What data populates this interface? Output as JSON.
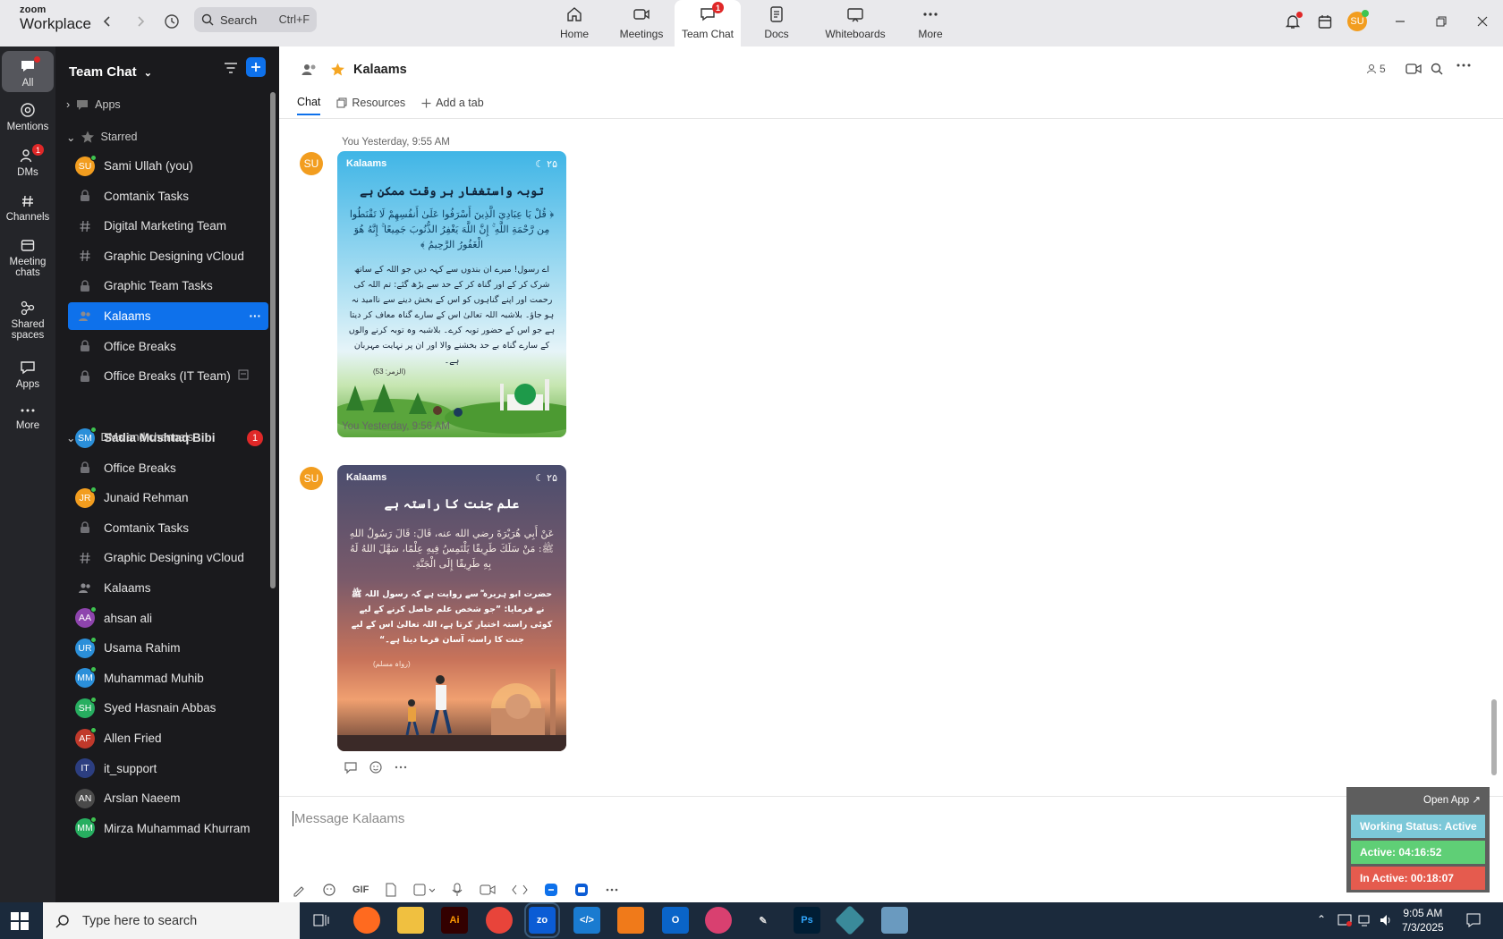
{
  "app": {
    "logo_top": "zoom",
    "logo_bottom": "Workplace"
  },
  "search": {
    "label": "Search",
    "shortcut": "Ctrl+F"
  },
  "nav_tabs": [
    {
      "label": "Home",
      "icon": "home-icon"
    },
    {
      "label": "Meetings",
      "icon": "video-icon"
    },
    {
      "label": "Team Chat",
      "icon": "chat-icon",
      "badge": "1",
      "active": true
    },
    {
      "label": "Docs",
      "icon": "doc-icon"
    },
    {
      "label": "Whiteboards",
      "icon": "whiteboard-icon"
    },
    {
      "label": "More",
      "icon": "more-icon"
    }
  ],
  "user_avatar": "SU",
  "rail": [
    {
      "label": "All",
      "active": true
    },
    {
      "label": "Mentions"
    },
    {
      "label": "DMs",
      "badge": "1"
    },
    {
      "label": "Channels"
    },
    {
      "label": "Meeting chats"
    },
    {
      "label": "Shared spaces"
    },
    {
      "label": "Apps"
    },
    {
      "label": "More"
    }
  ],
  "sidebar": {
    "title": "Team Chat",
    "apps_label": "Apps",
    "starred_label": "Starred",
    "dms_label": "DMs and channels",
    "starred": [
      {
        "label": "Sami Ullah (you)",
        "type": "avatar",
        "initials": "SU",
        "color": "#f29d1f",
        "online": true
      },
      {
        "label": "Comtanix Tasks",
        "type": "lock"
      },
      {
        "label": "Digital Marketing Team",
        "type": "hash"
      },
      {
        "label": "Graphic Designing vCloud",
        "type": "hash"
      },
      {
        "label": "Graphic Team Tasks",
        "type": "lock"
      },
      {
        "label": "Kalaams",
        "type": "group",
        "active": true
      },
      {
        "label": "Office Breaks",
        "type": "lock"
      },
      {
        "label": "Office Breaks (IT Team)",
        "type": "lock"
      }
    ],
    "dms": [
      {
        "label": "Sadia Mushtaq Bibi",
        "type": "avatar",
        "initials": "SM",
        "color": "#2b8fd9",
        "online": true,
        "badge": "1",
        "bold": true
      },
      {
        "label": "Office Breaks",
        "type": "lock"
      },
      {
        "label": "Junaid Rehman",
        "type": "avatar",
        "initials": "JR",
        "color": "#f29d1f",
        "online": true
      },
      {
        "label": "Comtanix Tasks",
        "type": "lock"
      },
      {
        "label": "Graphic Designing vCloud",
        "type": "hash"
      },
      {
        "label": "Kalaams",
        "type": "group"
      },
      {
        "label": "ahsan ali",
        "type": "avatar",
        "initials": "AA",
        "color": "#8e44ad",
        "online": true
      },
      {
        "label": "Usama Rahim",
        "type": "avatar",
        "initials": "UR",
        "color": "#2b8fd9",
        "online": true
      },
      {
        "label": "Muhammad Muhib",
        "type": "avatar",
        "initials": "MM",
        "color": "#2b8fd9",
        "online": true
      },
      {
        "label": "Syed Hasnain Abbas",
        "type": "avatar",
        "initials": "SH",
        "color": "#27ae60",
        "online": true
      },
      {
        "label": "Allen Fried",
        "type": "avatar",
        "initials": "AF",
        "color": "#c0392b",
        "online": true
      },
      {
        "label": "it_support",
        "type": "avatar",
        "initials": "IT",
        "color": "#2c3e80"
      },
      {
        "label": "Arslan Naeem",
        "type": "avatar",
        "initials": "AN",
        "color": "#4a4a4a"
      },
      {
        "label": "Mirza Muhammad Khurram",
        "type": "avatar",
        "initials": "MM",
        "color": "#27ae60",
        "online": true
      }
    ]
  },
  "channel": {
    "name": "Kalaams",
    "member_count": "5",
    "tabs": [
      "Chat",
      "Resources",
      "Add a tab"
    ]
  },
  "messages": [
    {
      "sender": "You",
      "time": "Yesterday, 9:55 AM",
      "avatar": "SU",
      "card": {
        "brand": "Kalaams",
        "heading": "توبہ واستغفار ہر وقت ممکن ہے",
        "arabic": "﴿ قُلْ يَا عِبَادِيَ الَّذِينَ أَسْرَفُوا عَلَىٰ أَنفُسِهِمْ لَا تَقْنَطُوا مِن رَّحْمَةِ اللَّهِ ۚ إِنَّ اللَّهَ يَغْفِرُ الذُّنُوبَ جَمِيعًا ۚ إِنَّهُ هُوَ الْغَفُورُ الرَّحِيمُ ﴾",
        "urdu": "اے رسول! میرے ان بندوں سے کہہ دیں جو اللہ کے ساتھ شرک کر کے اور گناہ کر کے حد سے بڑھ گئے: تم اللہ کی رحمت اور اپنے گناہوں کو اس کے بخش دینے سے ناامید نہ ہو جاؤ۔ بلاشبہ اللہ تعالیٰ اس کے سارے گناہ معاف کر دیتا ہے جو اس کے حضور توبہ کرے۔ بلاشبہ وہ توبہ کرنے والوں کے سارے گناہ بے حد بخشنے والا اور ان پر نہایت مہربان ہے۔",
        "ref": "(الزمر: 53)"
      }
    },
    {
      "sender": "You",
      "time": "Yesterday, 9:56 AM",
      "avatar": "SU",
      "card": {
        "brand": "Kalaams",
        "heading": "علم جنت کا راستہ ہے",
        "arabic": "عَنْ أَبِي هُرَيْرَةَ رضي الله عنه، قَالَ: قَالَ رَسُولُ اللهِ ﷺ: مَنْ سَلَكَ طَرِيقًا يَلْتَمِسُ فِيهِ عِلْمًا، سَهَّلَ اللهُ لَهُ بِهِ طَرِيقًا إِلَى الْجَنَّةِ.",
        "urdu": "حضرت ابو ہریرہ ؓ سے روایت ہے کہ رسول اللہ ﷺ نے فرمایا: ”جو شخص علم حاصل کرنے کے لیے کوئی راستہ اختیار کرتا ہے، اللہ تعالیٰ اس کے لیے جنت کا راستہ آسان فرما دیتا ہے۔“",
        "ref": "(رواہ مسلم)"
      }
    }
  ],
  "composer": {
    "placeholder": "Message Kalaams",
    "gif_label": "GIF"
  },
  "widget": {
    "open_label": "Open App ↗",
    "working_status": "Working Status: Active",
    "active": "Active: 04:16:52",
    "inactive": "In Active: 00:18:07"
  },
  "taskbar": {
    "search_placeholder": "Type here to search",
    "time": "9:05 AM",
    "date": "7/3/2025"
  },
  "colors": {
    "accent": "#0e71eb",
    "sidebar_bg": "#1a1a1d",
    "rail_bg": "#242529",
    "badge": "#e02828"
  }
}
